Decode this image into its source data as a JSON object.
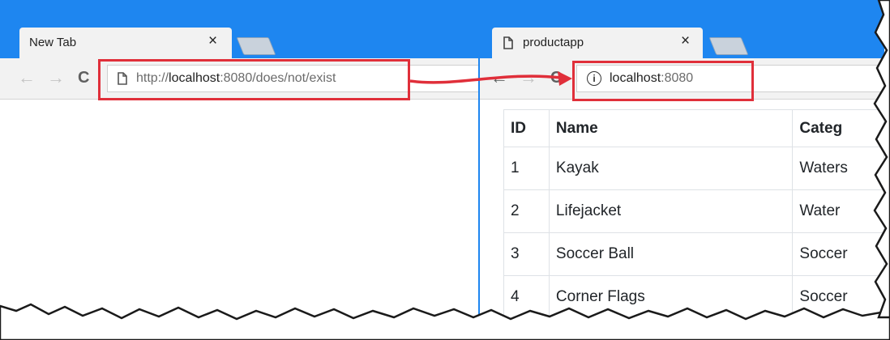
{
  "left_window": {
    "tab": {
      "title": "New Tab",
      "close": "×"
    },
    "toolbar": {
      "back": "←",
      "forward": "→",
      "reload": "C"
    },
    "address": {
      "scheme": "http://",
      "host": "localhost",
      "port": ":8080",
      "path": "/does/not/exist"
    }
  },
  "right_window": {
    "tab": {
      "title": "productapp",
      "close": "×"
    },
    "toolbar": {
      "back": "←",
      "forward": "→",
      "reload": "C"
    },
    "address": {
      "info": "i",
      "host": "localhost",
      "port": ":8080"
    },
    "table": {
      "headers": {
        "id": "ID",
        "name": "Name",
        "category": "Categ"
      },
      "rows": [
        {
          "id": "1",
          "name": "Kayak",
          "category": "Waters"
        },
        {
          "id": "2",
          "name": "Lifejacket",
          "category": "Water"
        },
        {
          "id": "3",
          "name": "Soccer Ball",
          "category": "Soccer"
        },
        {
          "id": "4",
          "name": "Corner Flags",
          "category": "Soccer"
        }
      ]
    }
  },
  "colors": {
    "titlebar": "#1e86f0",
    "highlight": "#e02f3a",
    "arrow": "#e02f3a"
  }
}
